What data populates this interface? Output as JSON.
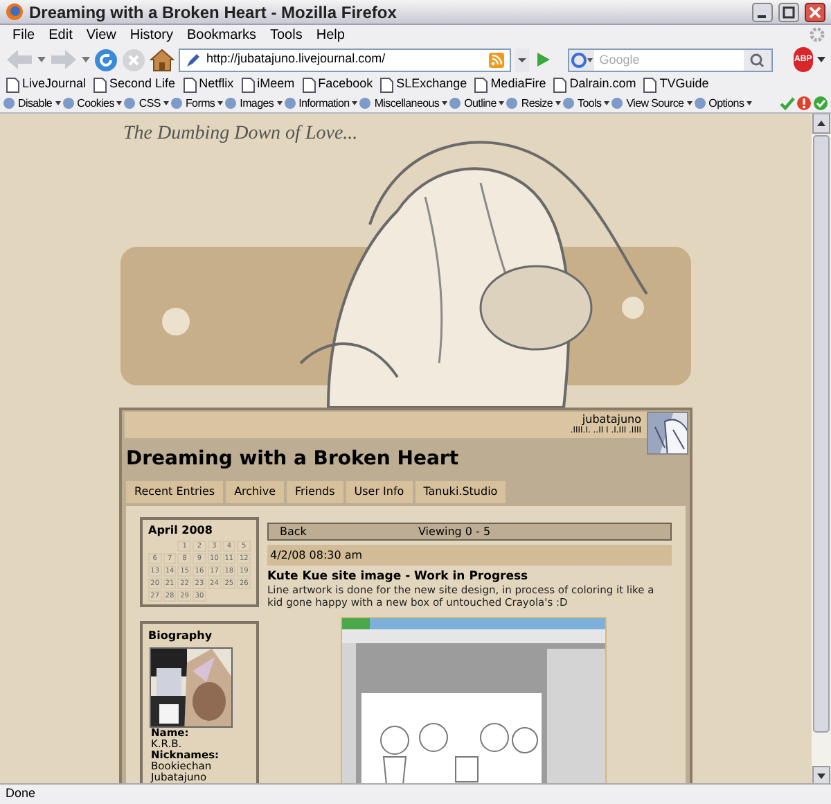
{
  "window": {
    "title": "Dreaming with a Broken Heart - Mozilla Firefox"
  },
  "menu": [
    "File",
    "Edit",
    "View",
    "History",
    "Bookmarks",
    "Tools",
    "Help"
  ],
  "nav": {
    "url": "http://jubatajuno.livejournal.com/",
    "search_placeholder": "Google",
    "adblock_label": "ABP"
  },
  "bookmarks": [
    "LiveJournal",
    "Second Life",
    "Netflix",
    "iMeem",
    "Facebook",
    "SLExchange",
    "MediaFire",
    "Dalrain.com",
    "TVGuide"
  ],
  "dev_toolbar": [
    "Disable",
    "Cookies",
    "CSS",
    "Forms",
    "Images",
    "Information",
    "Miscellaneous",
    "Outline",
    "Resize",
    "Tools",
    "View Source",
    "Options"
  ],
  "page": {
    "banner_title": "The Dumbing Down of Love...",
    "username": "jubatajuno",
    "user_tagline": ".IIII.I. ..II I .I.III .IIII",
    "journal_title": "Dreaming with a Broken Heart",
    "tabs": [
      "Recent Entries",
      "Archive",
      "Friends",
      "User Info",
      "Tanuki.Studio"
    ],
    "calendar": {
      "title": "April 2008",
      "weeks": [
        {
          "kind": "first",
          "days": [
            "1",
            "2",
            "3",
            "4",
            "5"
          ]
        },
        {
          "kind": "full",
          "days": [
            "6",
            "7",
            "8",
            "9",
            "10",
            "11",
            "12"
          ]
        },
        {
          "kind": "full",
          "days": [
            "13",
            "14",
            "15",
            "16",
            "17",
            "18",
            "19"
          ]
        },
        {
          "kind": "full",
          "days": [
            "20",
            "21",
            "22",
            "23",
            "24",
            "25",
            "26"
          ]
        },
        {
          "kind": "last",
          "days": [
            "27",
            "28",
            "29",
            "30"
          ]
        }
      ]
    },
    "biography": {
      "title": "Biography",
      "fields": [
        {
          "label": "Name:",
          "values": [
            "K.R.B."
          ]
        },
        {
          "label": "Nicknames:",
          "values": [
            "Bookiechan",
            "Jubatajuno"
          ]
        }
      ]
    },
    "entries_nav": {
      "back": "Back",
      "viewing": "Viewing 0 - 5"
    },
    "entry": {
      "date": "4/2/08 08:30 am",
      "title": "Kute Kue site image - Work in Progress",
      "body": "Line artwork is done for the new site design, in process of coloring it like a kid gone happy with a new box of untouched Crayola's :D"
    }
  },
  "status_bar": "Done"
}
